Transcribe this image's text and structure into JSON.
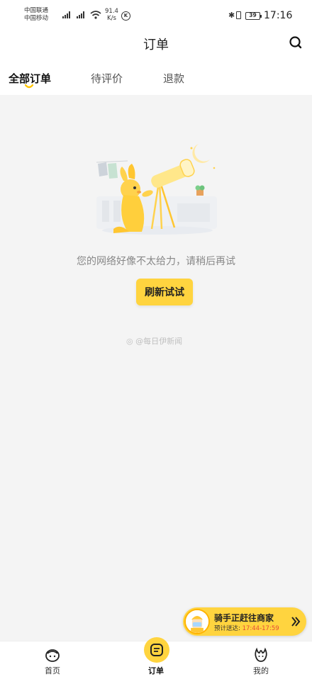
{
  "status_bar": {
    "carrier1": "中国联通",
    "carrier2": "中国移动",
    "net_speed": "91.4",
    "net_unit": "K/s",
    "battery": "39",
    "time": "17:16"
  },
  "header": {
    "title": "订单"
  },
  "tabs": [
    {
      "label": "全部订单"
    },
    {
      "label": "待评价"
    },
    {
      "label": "退款"
    }
  ],
  "empty_state": {
    "message": "您的网络好像不太给力，请稍后再试",
    "refresh_label": "刷新试试",
    "watermark": "@每日伊新闻"
  },
  "rider": {
    "title": "骑手正赶往商家",
    "eta_label": "预计送达:",
    "eta_time": "17:44-17:59"
  },
  "bottom_nav": [
    {
      "label": "首页"
    },
    {
      "label": "订单"
    },
    {
      "label": "我的"
    }
  ],
  "colors": {
    "accent": "#ffd43f",
    "eta_time": "#e64a3a"
  }
}
